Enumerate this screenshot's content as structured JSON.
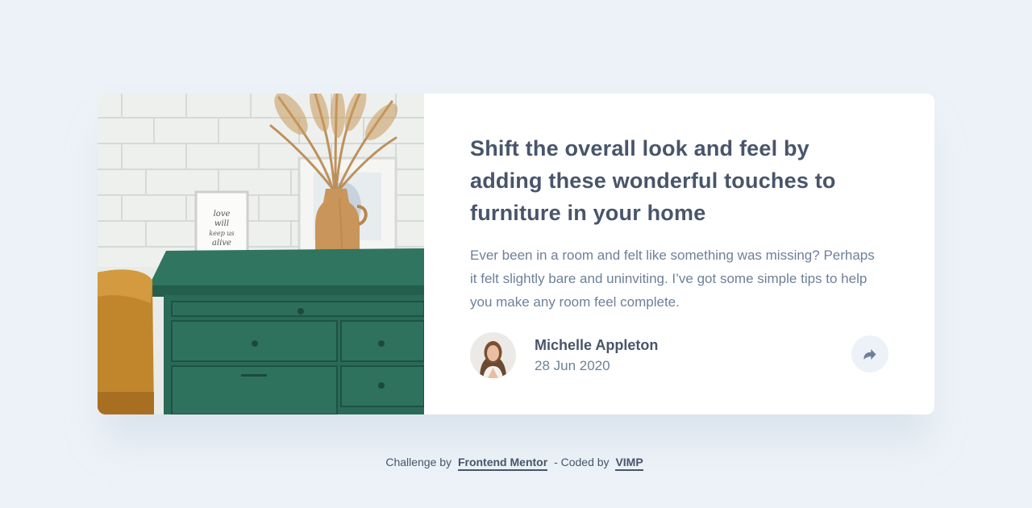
{
  "article": {
    "title": "Shift the overall look and feel by adding these wonderful touches to furniture in your home",
    "description": "Ever been in a room and felt like something was missing? Perhaps it felt slightly bare and uninviting. I’ve got some simple tips to help you make any room feel complete.",
    "author_name": "Michelle Appleton",
    "date": "28 Jun 2020",
    "share_icon": "share-arrow-icon"
  },
  "footer": {
    "prefix": "Challenge by",
    "link1": "Frontend Mentor",
    "middle": "- Coded by",
    "link2": "VIMP"
  },
  "colors": {
    "background": "#ecf2f8",
    "heading": "#48556a",
    "body_text": "#6e8098",
    "card": "#ffffff",
    "dresser_green": "#2c6e5a"
  }
}
